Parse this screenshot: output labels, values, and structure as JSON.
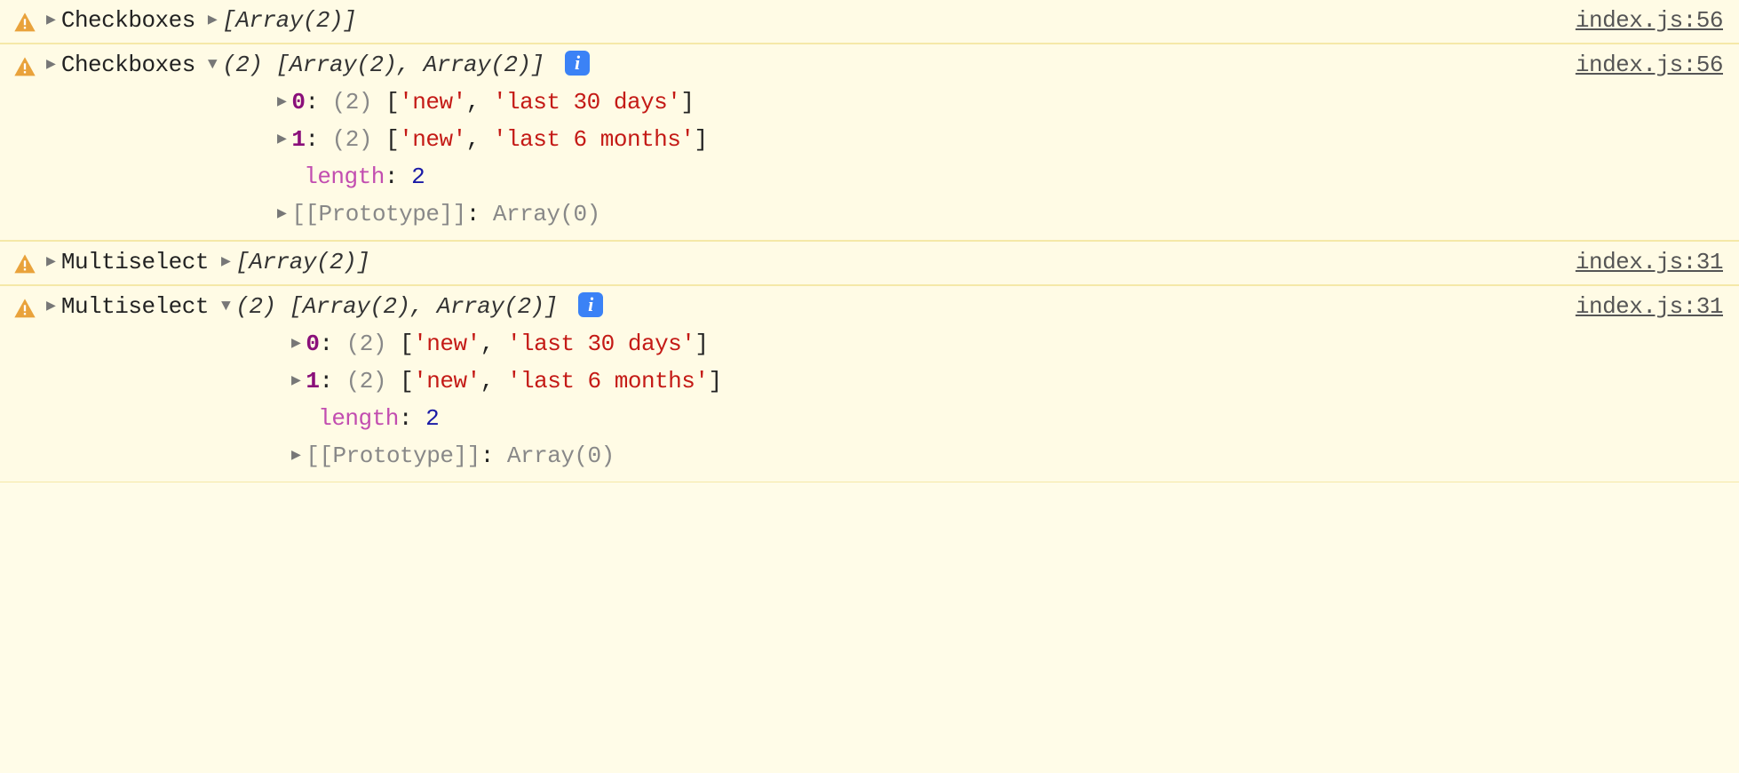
{
  "rows": [
    {
      "label": "Checkboxes",
      "collapsed_preview": "[Array(2)]",
      "source": "index.js:56",
      "expanded": false
    },
    {
      "label": "Checkboxes",
      "header_preview": "(2) [Array(2), Array(2)]",
      "source": "index.js:56",
      "expanded": true,
      "items": [
        {
          "idx": "0",
          "count": "(2)",
          "v0": "'new'",
          "v1": "'last 30 days'"
        },
        {
          "idx": "1",
          "count": "(2)",
          "v0": "'new'",
          "v1": "'last 6 months'"
        }
      ],
      "length_label": "length",
      "length_value": "2",
      "proto_label": "[[Prototype]]",
      "proto_value": "Array(0)"
    },
    {
      "label": "Multiselect",
      "collapsed_preview": "[Array(2)]",
      "source": "index.js:31",
      "expanded": false
    },
    {
      "label": "Multiselect",
      "header_preview": "(2) [Array(2), Array(2)]",
      "source": "index.js:31",
      "expanded": true,
      "items": [
        {
          "idx": "0",
          "count": "(2)",
          "v0": "'new'",
          "v1": "'last 30 days'"
        },
        {
          "idx": "1",
          "count": "(2)",
          "v0": "'new'",
          "v1": "'last 6 months'"
        }
      ],
      "length_label": "length",
      "length_value": "2",
      "proto_label": "[[Prototype]]",
      "proto_value": "Array(0)"
    }
  ],
  "info_badge": "i"
}
